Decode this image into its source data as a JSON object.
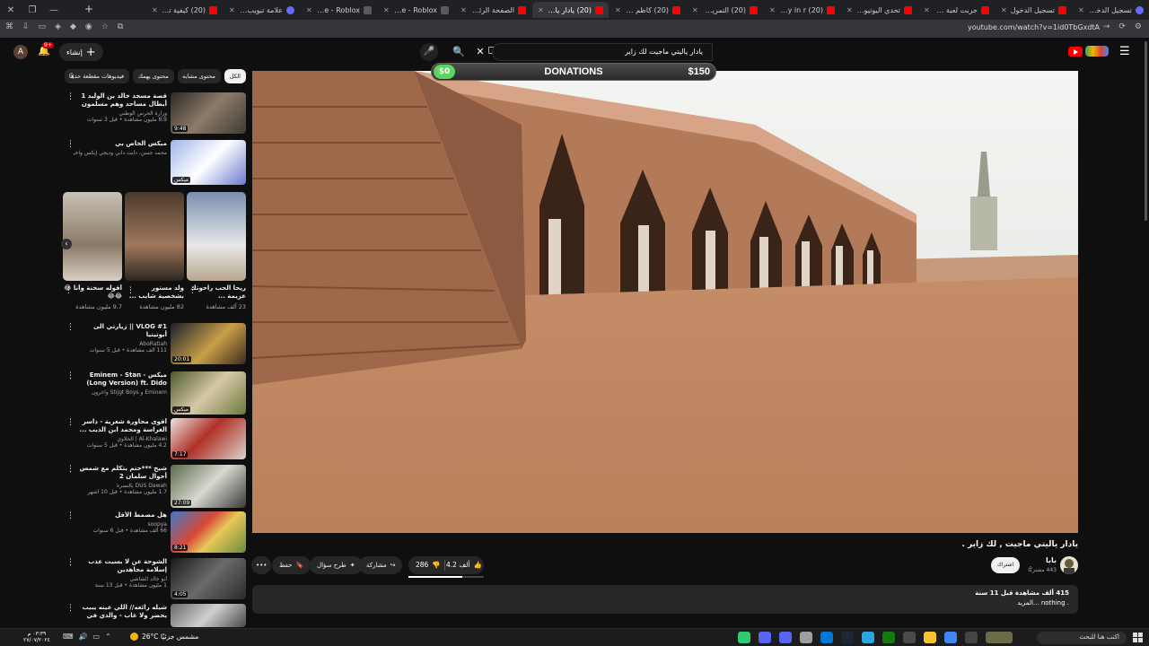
{
  "browser": {
    "tabs": [
      {
        "title": "تسجيل الدخول - مقد...",
        "fav": "gl"
      },
      {
        "title": "تسجيل الدخول",
        "fav": "yt"
      },
      {
        "title": "جربت لعبة رعب لقتل...",
        "fav": "yt"
      },
      {
        "title": "تحدي اليوتيوبرز الرم...",
        "fav": "yt"
      },
      {
        "title": "(20) how to buy in r...",
        "fav": "yt"
      },
      {
        "title": "(20) التمرين بالعلم...",
        "fav": "yt"
      },
      {
        "title": "(20) كاظم الساهر ...",
        "fav": "yt"
      },
      {
        "title": "(20) يادار ياليتي...",
        "fav": "yt",
        "active": true
      },
      {
        "title": "الصفحة الرئيسية",
        "fav": "yt"
      },
      {
        "title": "Home - Roblox",
        "fav": "rb"
      },
      {
        "title": "Home - Roblox",
        "fav": "rb"
      },
      {
        "title": "علامة تبويب جديدة",
        "fav": "gl"
      },
      {
        "title": "(20) كيفية تغيير ر...",
        "fav": "yt"
      }
    ],
    "url": "youtube.com/watch?v=1id0TbGxdtA"
  },
  "header": {
    "avatar_letter": "A",
    "notifications": "9+",
    "create_label": "إنشاء",
    "search_query": "يادار ياليتي ماجيت لك زاير"
  },
  "donation": {
    "current": "$0",
    "label": "DONATIONS",
    "goal": "$150",
    "progress": 0
  },
  "chips": [
    "الكل",
    "محتوى مشابه",
    "محتوى يهمك",
    "فيديوهات مقطعة حديثًا"
  ],
  "recommendations_top": [
    {
      "title": "قصة مسجد خالد بن الوليد 1 أبطال مساحد وهم مسلمون في يوم @ عمرة واحد...",
      "channel": "وزارة الحرس الوطني",
      "meta": "8.9 مليون مشاهدة • قبل 3 سنوات",
      "duration": "9:48"
    },
    {
      "title": "ميكس الخاص بي",
      "channel": "محمد حسن، دايت دابي وديجي إيكس وآخرون",
      "meta": "",
      "duration": "ميكس"
    }
  ],
  "shorts": [
    {
      "title": "ريحا الحب راحوتك عزيمة ...",
      "views": "23 ألف مشاهدة"
    },
    {
      "title": "ولد مستور بشخصية شايب ...",
      "views": "82 مليون مشاهدة"
    },
    {
      "title": "أقوله سخنة وأنا 😂😂😂",
      "views": "9.7 مليون مشاهدة"
    }
  ],
  "recommendations": [
    {
      "title": "VLOG #1 || زيارتي الى أبوتيتيا",
      "channel": "AboRatiah",
      "meta": "111 ألف مشاهدة • قبل 5 سنوات",
      "duration": "20:01",
      "thumb": "t1"
    },
    {
      "title": "ميكس - Eminem - Stan (Long Version) ft. Dido",
      "channel": "Eminem و Stijgt Boys وآخرون",
      "meta": "",
      "duration": "ميكس",
      "thumb": "t2"
    },
    {
      "title": "أقوى محاورة شعرية - ذاسر الغراسة ومحمد ابن الذيب ...",
      "channel": "Al-Khalawi | الخلاوي",
      "meta": "4.2 مليون مشاهدة • قبل 5 سنوات",
      "duration": "7:17",
      "thumb": "t3"
    },
    {
      "title": "شيخ ***حتم يتكلم مع شمس أحوال سلمان 2",
      "channel": "DUS Dawah بالنصرة",
      "meta": "1.7 مليون مشاهدة • قبل 10 أشهر",
      "duration": "27:09",
      "thumb": "t4"
    },
    {
      "title": "هل مصمط الأقل",
      "channel": "soopya",
      "meta": "66 ألف مشاهدة • قبل 6 سنوات",
      "duration": "8:21",
      "thumb": "t5"
    },
    {
      "title": "الشوحة عن لا بسيت عذب إسلامة مجاهدين",
      "channel": "أبو خالد الشاشي",
      "meta": "1 مليون مشاهدة • قبل 13 سنة",
      "duration": "4:05",
      "thumb": "t6"
    },
    {
      "title": "شيله رائعه// اللي عينه يبيب يحضر ولا غاب - والذي في شوفه تبعدا عيانه // خالد...",
      "channel": "",
      "meta": "",
      "duration": "",
      "thumb": "t7"
    }
  ],
  "video": {
    "title": "يادار ياليتي ماجيت , لك زاير .",
    "channel": "بابا",
    "subscribers": "443 مشتركًا",
    "subscribe_label": "اشتراك",
    "likes": "4.2 ألف",
    "dislikes": "286",
    "like_ratio": 0.72,
    "share_label": "مشاركة",
    "ask_label": "طرح سؤال",
    "save_label": "حفظ",
    "more_label": "•••",
    "views_line": "415 ألف مشاهدة  قبل 11 سنة",
    "desc_line": ". nothing  ...المزيد"
  },
  "taskbar": {
    "time": "٠٣:٣٩ م",
    "date": "٢٧/٠٧/٢٠٢٤",
    "weather": "26°C  مشمس جزئيًا",
    "search_placeholder": "اكتب هنا للبحث"
  },
  "colors": {
    "youtube_red": "#ff0000",
    "donation_green": "#5fd35f",
    "background": "#0f0f0f"
  }
}
